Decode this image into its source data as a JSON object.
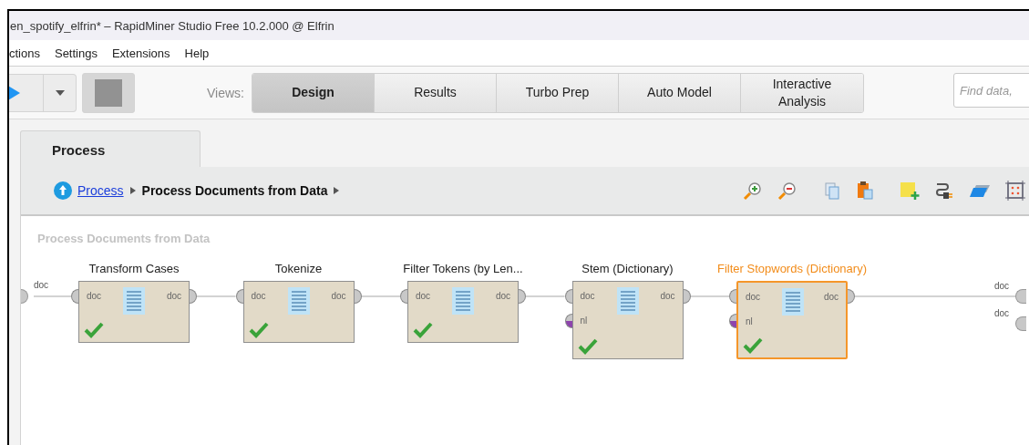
{
  "window": {
    "title": "en_spotify_elfrin* – RapidMiner Studio Free 10.2.000 @ Elfrin"
  },
  "menu": [
    {
      "label": "ctions"
    },
    {
      "label": "Settings"
    },
    {
      "label": "Extensions"
    },
    {
      "label": "Help"
    }
  ],
  "toolbar": {
    "views_label": "Views:",
    "views": [
      {
        "label": "Design",
        "selected": true
      },
      {
        "label": "Results",
        "selected": false
      },
      {
        "label": "Turbo Prep",
        "selected": false
      },
      {
        "label": "Auto Model",
        "selected": false
      },
      {
        "label": "Interactive Analysis",
        "selected": false
      }
    ],
    "search": {
      "placeholder": "Find data,"
    }
  },
  "process_tab": {
    "label": "Process"
  },
  "breadcrumb": {
    "link": "Process",
    "current": "Process Documents from Data"
  },
  "canvas": {
    "caption": "Process Documents from Data",
    "input_ports": [
      {
        "label": "doc"
      }
    ],
    "output_ports": [
      {
        "label": "doc"
      },
      {
        "label": "doc"
      }
    ],
    "operators": [
      {
        "name": "Transform Cases",
        "selected": false,
        "ok": true,
        "inputs": [
          {
            "label": "doc",
            "kind": "document"
          }
        ],
        "outputs": [
          {
            "label": "doc"
          }
        ]
      },
      {
        "name": "Tokenize",
        "selected": false,
        "ok": true,
        "inputs": [
          {
            "label": "doc",
            "kind": "document"
          }
        ],
        "outputs": [
          {
            "label": "doc"
          }
        ]
      },
      {
        "name": "Filter Tokens (by Len...",
        "selected": false,
        "ok": true,
        "inputs": [
          {
            "label": "doc",
            "kind": "document"
          }
        ],
        "outputs": [
          {
            "label": "doc"
          }
        ]
      },
      {
        "name": "Stem (Dictionary)",
        "selected": false,
        "ok": true,
        "inputs": [
          {
            "label": "doc",
            "kind": "document"
          },
          {
            "label": "nl",
            "kind": "wordlist"
          }
        ],
        "outputs": [
          {
            "label": "doc"
          }
        ]
      },
      {
        "name": "Filter Stopwords (Dictionary)",
        "selected": true,
        "ok": true,
        "inputs": [
          {
            "label": "doc",
            "kind": "document"
          },
          {
            "label": "nl",
            "kind": "wordlist"
          }
        ],
        "outputs": [
          {
            "label": "doc"
          }
        ]
      }
    ]
  }
}
